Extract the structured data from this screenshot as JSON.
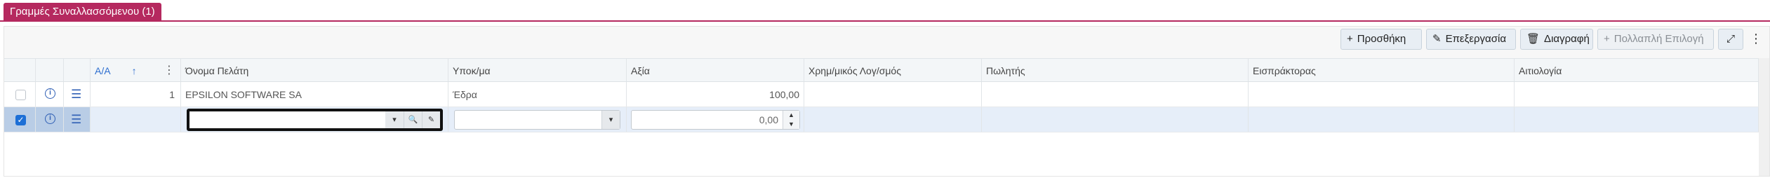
{
  "tab": {
    "label": "Γραμμές Συναλλασσόμενου (1)"
  },
  "toolbar": {
    "add_label": "Προσθήκη",
    "edit_label": "Επεξεργασία",
    "delete_label": "Διαγραφή",
    "multi_label": "Πολλαπλή Επιλογή",
    "add_icon": "+",
    "edit_icon": "✎",
    "delete_icon": "🗑",
    "multi_icon": "+",
    "expand_icon": "⤢",
    "more_icon": "⋮"
  },
  "columns": {
    "aa": "Α/Α",
    "aa_sort": "↑",
    "customer": "Όνομα Πελάτη",
    "branch": "Υποκ/μα",
    "value": "Αξία",
    "account": "Χρημ/μικός Λογ/σμός",
    "seller": "Πωλητής",
    "collector": "Εισπράκτορας",
    "reason": "Αιτιολογία",
    "col_more": "⋮"
  },
  "rows": [
    {
      "aa": "1",
      "customer": "EPSILON SOFTWARE SA",
      "branch": "Έδρα",
      "value": "100,00",
      "selected": false
    },
    {
      "aa": "",
      "customer": "",
      "branch": "",
      "value": "0,00",
      "selected": true
    }
  ],
  "icons": {
    "info": "i",
    "menu": "☰",
    "check": "✓",
    "dropdown": "▾",
    "search": "🔍",
    "pencil": "✎",
    "up": "▲",
    "down": "▼"
  },
  "colors": {
    "accent": "#b5295f",
    "selection": "#e6eef9",
    "link": "#2f5fb5"
  }
}
